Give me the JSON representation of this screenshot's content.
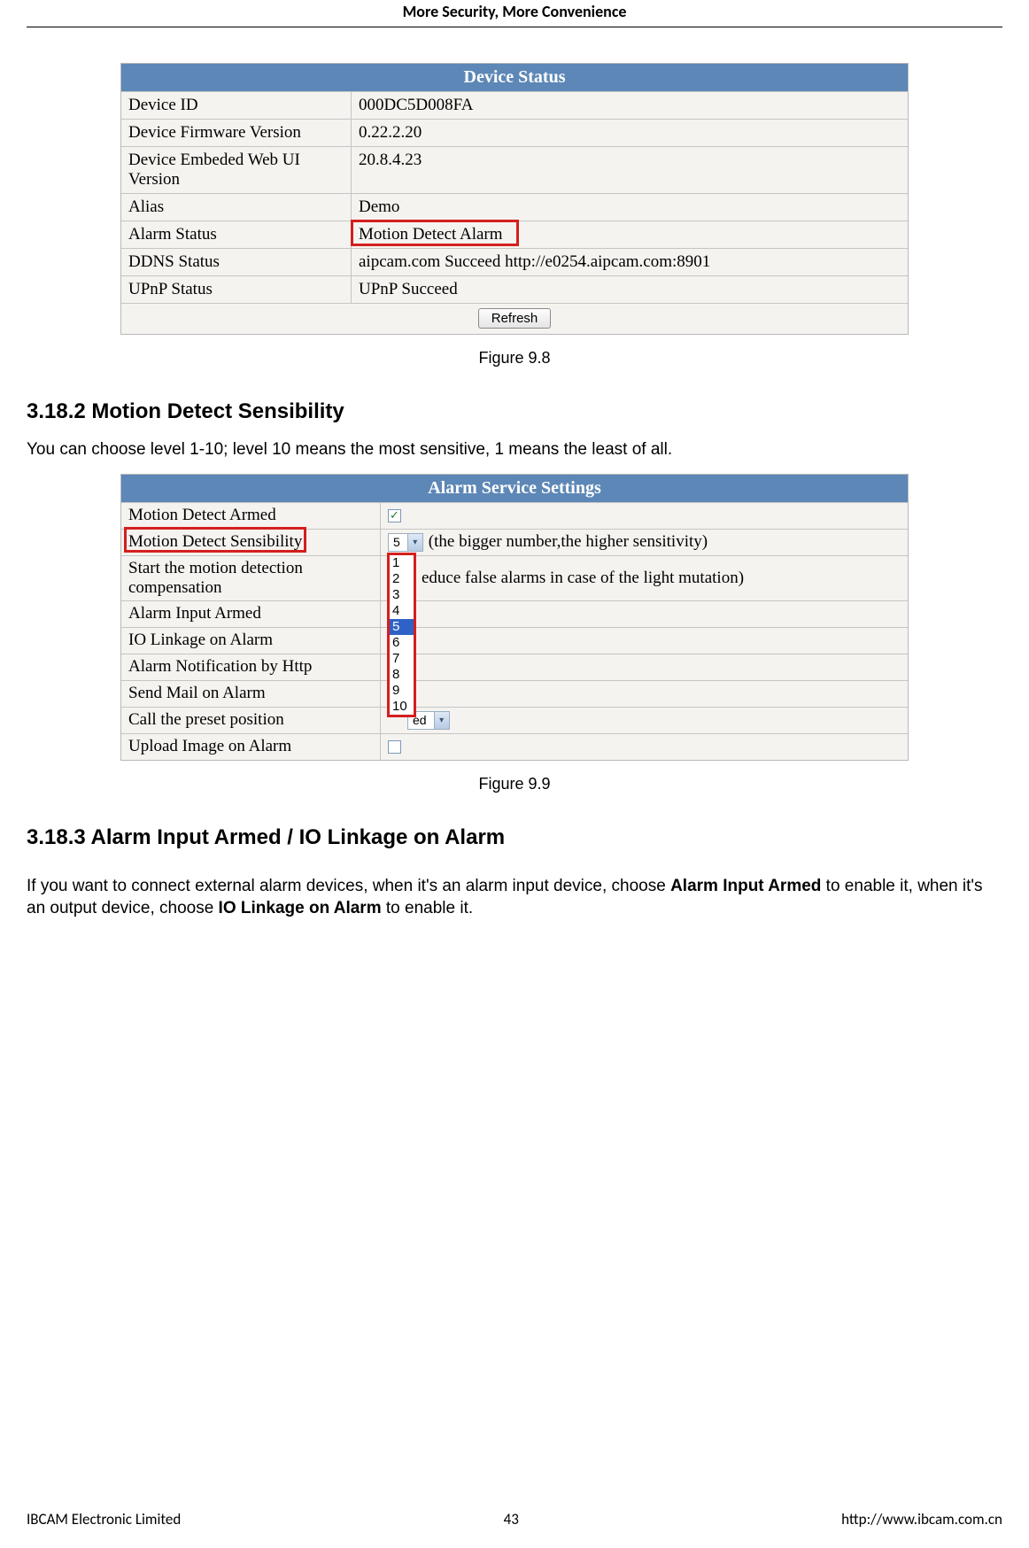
{
  "header_title": "More Security, More Convenience",
  "footer": {
    "left": "IBCAM Electronic Limited",
    "center": "43",
    "right": "http://www.ibcam.com.cn"
  },
  "figure1": {
    "title": "Device Status",
    "rows": [
      {
        "label": "Device ID",
        "value": "000DC5D008FA"
      },
      {
        "label": "Device Firmware Version",
        "value": "0.22.2.20"
      },
      {
        "label": "Device Embeded Web UI Version",
        "value": "20.8.4.23"
      },
      {
        "label": "Alias",
        "value": "Demo"
      },
      {
        "label": "Alarm Status",
        "value": "Motion Detect Alarm",
        "highlight": true
      },
      {
        "label": "DDNS Status",
        "value": "aipcam.com  Succeed  http://e0254.aipcam.com:8901"
      },
      {
        "label": "UPnP Status",
        "value": "UPnP Succeed"
      }
    ],
    "refresh_label": "Refresh",
    "caption": "Figure 9.8"
  },
  "section1": {
    "heading": "3.18.2 Motion Detect Sensibility",
    "text": "You can choose level 1-10; level 10 means the most sensitive, 1 means the least of all."
  },
  "figure2": {
    "title": "Alarm Service Settings",
    "rows": [
      {
        "label": "Motion Detect Armed",
        "type": "checkbox",
        "checked": true
      },
      {
        "label": "Motion Detect Sensibility",
        "type": "select_with_note",
        "value": "5",
        "note": "(the bigger number,the higher sensitivity)"
      },
      {
        "label": "Start the motion detection compensation",
        "type": "note_tail",
        "note": "educe false alarms in case of the light mutation)"
      },
      {
        "label": "Alarm Input Armed",
        "type": "blank"
      },
      {
        "label": "IO Linkage on Alarm",
        "type": "blank"
      },
      {
        "label": "Alarm Notification by Http",
        "type": "blank"
      },
      {
        "label": "Send Mail on Alarm",
        "type": "blank"
      },
      {
        "label": "Call the preset position",
        "type": "select_partial",
        "value": "ed"
      },
      {
        "label": "Upload Image on Alarm",
        "type": "checkbox_empty"
      }
    ],
    "dropdown_options": [
      "1",
      "2",
      "3",
      "4",
      "5",
      "6",
      "7",
      "8",
      "9",
      "10"
    ],
    "dropdown_selected": "5",
    "caption": "Figure 9.9"
  },
  "section2": {
    "heading": "3.18.3 Alarm Input Armed / IO Linkage on Alarm",
    "text_pre": "If you want to connect external alarm devices, when it's an alarm input device, choose ",
    "bold1": "Alarm Input Armed",
    "text_mid": " to enable it, when it's an output device, choose ",
    "bold2": "IO Linkage on Alarm",
    "text_post": " to enable it."
  }
}
